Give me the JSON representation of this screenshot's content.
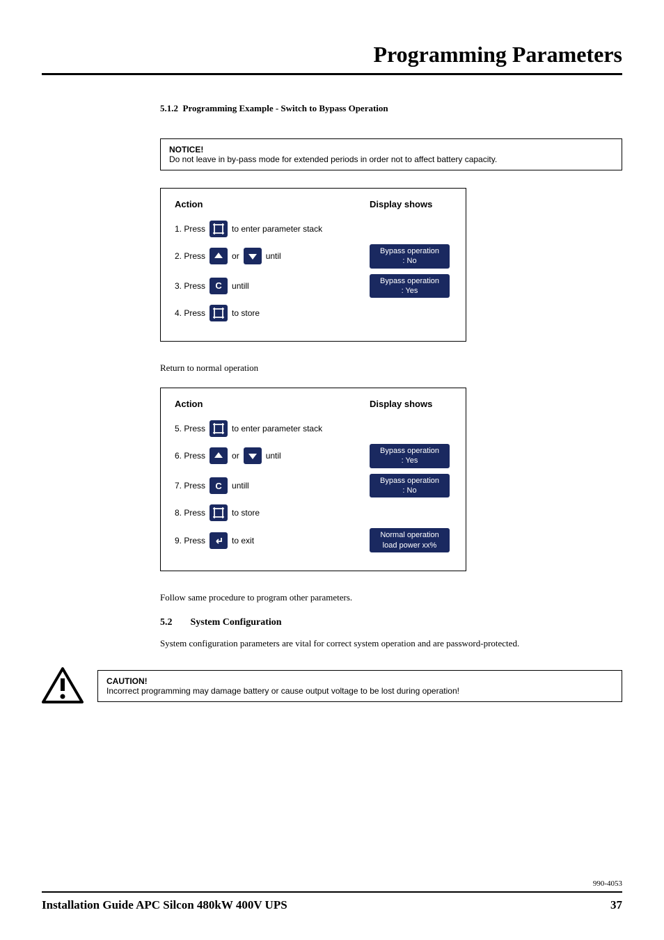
{
  "chapter_title": "Programming Parameters",
  "subsection": {
    "number": "5.1.2",
    "title": "Programming Example - Switch to Bypass Operation"
  },
  "notice": {
    "label": "NOTICE!",
    "text": "Do not leave in by-pass mode for extended periods in order not to affect battery capacity."
  },
  "table1": {
    "header_action": "Action",
    "header_display": "Display shows",
    "rows": [
      {
        "step": "1. Press",
        "icon": "frame",
        "after": "to enter parameter stack",
        "display_l1": "",
        "display_l2": ""
      },
      {
        "step": "2. Press",
        "icon": "up",
        "mid": "or",
        "icon2": "down",
        "after": "until",
        "display_l1": "Bypass operation",
        "display_l2": ": No"
      },
      {
        "step": "3. Press",
        "icon": "C",
        "after": "untill",
        "display_l1": "Bypass operation",
        "display_l2": ": Yes"
      },
      {
        "step": "4. Press",
        "icon": "frame",
        "after": "to store",
        "display_l1": "",
        "display_l2": ""
      }
    ]
  },
  "return_text": "Return to normal operation",
  "table2": {
    "header_action": "Action",
    "header_display": "Display shows",
    "rows": [
      {
        "step": "5. Press",
        "icon": "frame",
        "after": "to enter parameter stack",
        "display_l1": "",
        "display_l2": ""
      },
      {
        "step": "6. Press",
        "icon": "up",
        "mid": "or",
        "icon2": "down",
        "after": "until",
        "display_l1": "Bypass operation",
        "display_l2": ": Yes"
      },
      {
        "step": "7. Press",
        "icon": "C",
        "after": "untill",
        "display_l1": "Bypass operation",
        "display_l2": ": No"
      },
      {
        "step": "8. Press",
        "icon": "frame",
        "after": "to store",
        "display_l1": "",
        "display_l2": ""
      },
      {
        "step": "9. Press",
        "icon": "enter",
        "after": "to exit",
        "display_l1": "Normal operation",
        "display_l2": "load power   xx%"
      }
    ]
  },
  "follow_text": "Follow same procedure to program other parameters.",
  "section52": {
    "number": "5.2",
    "title": "System Configuration",
    "body": "System configuration parameters are vital for correct system operation and are password-protected."
  },
  "caution": {
    "label": "CAUTION!",
    "text": "Incorrect programming may damage battery or cause output voltage to be lost during operation!"
  },
  "doc_number": "990-4053",
  "footer_title": "Installation Guide APC Silcon 480kW 400V UPS",
  "page_number": "37"
}
